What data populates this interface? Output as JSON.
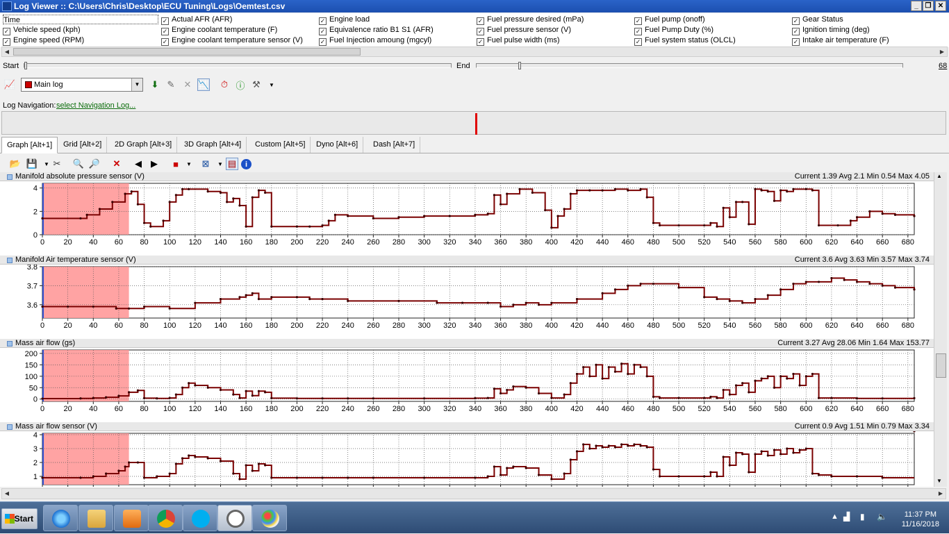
{
  "window": {
    "title": "Log Viewer :: C:\\Users\\Chris\\Desktop\\ECU Tuning\\Logs\\Oemtest.csv"
  },
  "channels": [
    {
      "label": "Time",
      "checked": false
    },
    {
      "label": "Actual AFR (AFR)",
      "checked": true
    },
    {
      "label": "Engine load",
      "checked": true
    },
    {
      "label": "Fuel pressure desired (mPa)",
      "checked": true
    },
    {
      "label": "Fuel pump (onoff)",
      "checked": true
    },
    {
      "label": "Gear Status",
      "checked": true
    },
    {
      "label": "Vehicle speed (kph)",
      "checked": true
    },
    {
      "label": "Engine coolant temperature (F)",
      "checked": true
    },
    {
      "label": "Equivalence ratio B1 S1 (AFR)",
      "checked": true
    },
    {
      "label": "Fuel pressure sensor (V)",
      "checked": true
    },
    {
      "label": "Fuel Pump Duty (%)",
      "checked": true
    },
    {
      "label": "Ignition timing (deg)",
      "checked": true
    },
    {
      "label": "Engine speed (RPM)",
      "checked": true
    },
    {
      "label": "Engine coolant temperature sensor (V)",
      "checked": true
    },
    {
      "label": "Fuel Injection amoung (mgcyl)",
      "checked": true
    },
    {
      "label": "Fuel pulse width (ms)",
      "checked": true
    },
    {
      "label": "Fuel system status (OLCL)",
      "checked": true
    },
    {
      "label": "Intake air temperature (F)",
      "checked": true
    }
  ],
  "range": {
    "start_label": "Start",
    "end_label": "End",
    "end_value": "68"
  },
  "log_selector": {
    "value": "Main log",
    "color": "#cc0000"
  },
  "navigation": {
    "label": "Log Navigation:",
    "link": "select Navigation Log..."
  },
  "tabs": [
    "Graph [Alt+1]",
    "Grid [Alt+2]",
    "2D Graph [Alt+3]",
    "3D Graph [Alt+4]",
    "Custom [Alt+5]",
    "Dyno [Alt+6]",
    "Dash [Alt+7]"
  ],
  "active_tab": 0,
  "series_color": "#7a0000",
  "selection_color": "#ff9999",
  "chart_data": [
    {
      "type": "line",
      "name": "Manifold absolute pressure sensor (V)",
      "stats": "Current 1.39 Avg 2.1 Min 0.54 Max 4.05",
      "ylim": [
        0,
        4.4
      ],
      "yticks": [
        "0",
        "2",
        "4"
      ],
      "ytick_values": [
        0,
        2,
        4
      ],
      "xlim": [
        0,
        685
      ],
      "highlight": [
        0,
        68
      ],
      "x": [
        0,
        30,
        35,
        45,
        55,
        65,
        70,
        75,
        80,
        85,
        95,
        100,
        105,
        110,
        115,
        130,
        140,
        145,
        150,
        155,
        160,
        165,
        170,
        175,
        180,
        200,
        210,
        220,
        225,
        230,
        240,
        260,
        280,
        300,
        320,
        340,
        350,
        355,
        360,
        365,
        375,
        385,
        395,
        400,
        405,
        410,
        415,
        420,
        430,
        440,
        450,
        460,
        470,
        475,
        480,
        485,
        500,
        520,
        525,
        530,
        535,
        540,
        545,
        550,
        555,
        560,
        565,
        570,
        575,
        580,
        585,
        590,
        600,
        605,
        610,
        625,
        635,
        640,
        650,
        660,
        670,
        685
      ],
      "y": [
        1.4,
        1.4,
        1.7,
        2.2,
        2.8,
        3.5,
        3.7,
        2.6,
        1,
        0.7,
        1.2,
        2.8,
        3.4,
        3.9,
        3.9,
        3.7,
        3.6,
        2.8,
        3.1,
        2.5,
        0.7,
        3.2,
        3.8,
        3.6,
        0.7,
        0.7,
        0.7,
        0.8,
        1.2,
        1.7,
        1.6,
        1.4,
        1.5,
        1.6,
        1.6,
        1.7,
        1.8,
        3.4,
        2.6,
        3.5,
        3.9,
        3.6,
        2.1,
        0.6,
        1.6,
        2.2,
        3.5,
        3.8,
        3.8,
        3.8,
        3.9,
        3.8,
        3.9,
        3.2,
        1,
        0.8,
        0.8,
        0.8,
        1,
        0.7,
        2.3,
        1.5,
        2.8,
        2.8,
        0.9,
        3.9,
        3.8,
        3.7,
        2.9,
        3.8,
        3.7,
        3.9,
        3.9,
        3.8,
        0.8,
        0.8,
        1.2,
        1.5,
        2,
        1.8,
        1.7,
        1.6
      ]
    },
    {
      "type": "line",
      "name": "Manifold Air temperature sensor (V)",
      "stats": "Current 3.6 Avg 3.63 Min 3.57 Max 3.74",
      "ylim": [
        3.53,
        3.8
      ],
      "yticks": [
        "3.6",
        "3.7",
        "3.8"
      ],
      "ytick_values": [
        3.6,
        3.7,
        3.8
      ],
      "xlim": [
        0,
        685
      ],
      "highlight": [
        0,
        68
      ],
      "x": [
        0,
        20,
        40,
        58,
        68,
        80,
        100,
        120,
        140,
        155,
        160,
        165,
        170,
        180,
        200,
        210,
        220,
        240,
        280,
        310,
        330,
        350,
        360,
        370,
        380,
        390,
        400,
        420,
        440,
        450,
        460,
        470,
        480,
        500,
        520,
        530,
        540,
        550,
        560,
        570,
        580,
        590,
        600,
        610,
        620,
        630,
        640,
        650,
        660,
        670,
        685
      ],
      "y": [
        3.59,
        3.59,
        3.59,
        3.58,
        3.58,
        3.59,
        3.58,
        3.61,
        3.63,
        3.64,
        3.65,
        3.66,
        3.63,
        3.64,
        3.64,
        3.63,
        3.63,
        3.62,
        3.62,
        3.61,
        3.61,
        3.61,
        3.59,
        3.6,
        3.61,
        3.6,
        3.61,
        3.63,
        3.66,
        3.68,
        3.7,
        3.71,
        3.71,
        3.69,
        3.64,
        3.63,
        3.62,
        3.61,
        3.63,
        3.65,
        3.68,
        3.71,
        3.72,
        3.72,
        3.74,
        3.73,
        3.72,
        3.71,
        3.7,
        3.69,
        3.68
      ]
    },
    {
      "type": "line",
      "name": "Mass air flow (gs)",
      "stats": "Current 3.27 Avg 28.06 Min 1.64 Max 153.77",
      "ylim": [
        -10,
        215
      ],
      "yticks": [
        "0",
        "50",
        "100",
        "150",
        "200"
      ],
      "ytick_values": [
        0,
        50,
        100,
        150,
        200
      ],
      "xlim": [
        0,
        685
      ],
      "highlight": [
        0,
        68
      ],
      "x": [
        0,
        30,
        40,
        50,
        60,
        68,
        75,
        80,
        90,
        100,
        105,
        110,
        115,
        120,
        130,
        140,
        150,
        155,
        160,
        165,
        170,
        175,
        180,
        200,
        220,
        240,
        260,
        300,
        340,
        350,
        355,
        360,
        365,
        370,
        380,
        390,
        400,
        410,
        415,
        420,
        425,
        430,
        435,
        440,
        445,
        450,
        455,
        460,
        465,
        470,
        475,
        480,
        485,
        500,
        520,
        525,
        530,
        535,
        540,
        545,
        550,
        555,
        560,
        565,
        570,
        575,
        580,
        585,
        590,
        595,
        600,
        605,
        610,
        620,
        640,
        660,
        685
      ],
      "y": [
        2,
        3,
        5,
        8,
        14,
        30,
        38,
        4,
        3,
        5,
        20,
        50,
        70,
        60,
        50,
        40,
        20,
        5,
        35,
        15,
        35,
        30,
        4,
        3,
        3,
        3,
        3,
        3,
        4,
        5,
        45,
        25,
        40,
        55,
        50,
        25,
        5,
        20,
        70,
        110,
        140,
        100,
        150,
        90,
        140,
        120,
        155,
        110,
        150,
        140,
        100,
        10,
        5,
        5,
        5,
        10,
        5,
        40,
        20,
        60,
        70,
        30,
        80,
        90,
        100,
        50,
        100,
        90,
        110,
        60,
        100,
        110,
        5,
        5,
        3,
        3,
        4
      ]
    },
    {
      "type": "line",
      "name": "Mass air flow sensor (V)",
      "stats": "Current 0.9 Avg 1.51 Min 0.79 Max 3.34",
      "ylim": [
        0.4,
        4.1
      ],
      "yticks": [
        "1",
        "2",
        "3",
        "4"
      ],
      "ytick_values": [
        1,
        2,
        3,
        4
      ],
      "xlim": [
        0,
        685
      ],
      "highlight": [
        0,
        68
      ],
      "x": [
        0,
        30,
        40,
        50,
        60,
        65,
        68,
        75,
        80,
        90,
        100,
        105,
        110,
        115,
        120,
        130,
        140,
        150,
        155,
        160,
        165,
        170,
        175,
        180,
        200,
        220,
        240,
        260,
        300,
        340,
        350,
        355,
        360,
        365,
        370,
        380,
        390,
        400,
        410,
        415,
        420,
        425,
        430,
        435,
        440,
        445,
        450,
        455,
        460,
        465,
        470,
        475,
        480,
        485,
        500,
        520,
        525,
        530,
        535,
        540,
        545,
        550,
        555,
        560,
        565,
        570,
        575,
        580,
        585,
        590,
        595,
        600,
        605,
        610,
        620,
        640,
        660,
        685
      ],
      "y": [
        0.9,
        0.9,
        1,
        1.2,
        1.4,
        1.7,
        2,
        2,
        0.9,
        1,
        1.2,
        1.9,
        2.3,
        2.5,
        2.4,
        2.3,
        2.1,
        1.2,
        0.8,
        1.8,
        1.4,
        1.9,
        1.8,
        0.9,
        0.9,
        0.9,
        0.9,
        0.9,
        0.9,
        0.9,
        1,
        1.7,
        1.1,
        1.6,
        1.7,
        1.6,
        1.1,
        0.8,
        1.2,
        2.2,
        2.8,
        3.3,
        3,
        3.2,
        3.1,
        3.2,
        3.1,
        3.3,
        3.2,
        3.3,
        3.2,
        3.1,
        1.5,
        1,
        1,
        1,
        1.3,
        1,
        2.4,
        1.8,
        2.7,
        2.6,
        1.3,
        2.6,
        2.8,
        2.5,
        2.9,
        2.6,
        3,
        2.7,
        2.9,
        3,
        1.2,
        1.1,
        1,
        1,
        0.9
      ]
    }
  ],
  "x_ticks": [
    0,
    20,
    40,
    60,
    80,
    100,
    120,
    140,
    160,
    180,
    200,
    220,
    240,
    260,
    280,
    300,
    320,
    340,
    360,
    380,
    400,
    420,
    440,
    460,
    480,
    500,
    520,
    540,
    560,
    580,
    600,
    620,
    640,
    660,
    680
  ],
  "taskbar": {
    "start_label": "Start",
    "time": "11:37 PM",
    "date": "11/16/2018"
  }
}
